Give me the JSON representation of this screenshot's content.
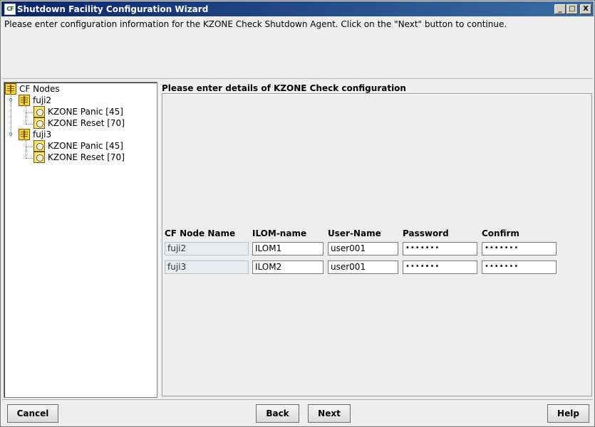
{
  "window": {
    "title": "Shutdown Facility Configuration Wizard",
    "icon_label": "CF",
    "minimize": "_",
    "maximize": "□",
    "close": "X"
  },
  "instructions": "Please enter configuration information for the KZONE Check Shutdown Agent. Click on the \"Next\" button to continue.",
  "tree": {
    "root": "CF Nodes",
    "nodes": [
      {
        "label": "fuji2",
        "children": [
          "KZONE Panic [45]",
          "KZONE Reset [70]"
        ]
      },
      {
        "label": "fuji3",
        "children": [
          "KZONE Panic [45]",
          "KZONE Reset [70]"
        ]
      }
    ]
  },
  "config": {
    "title": "Please enter details of KZONE Check configuration",
    "columns": [
      "CF Node Name",
      "ILOM-name",
      "User-Name",
      "Password",
      "Confirm"
    ],
    "rows": [
      {
        "node": "fuji2",
        "ilom": "ILOM1",
        "user": "user001",
        "password": "•••••••",
        "confirm": "•••••••"
      },
      {
        "node": "fuji3",
        "ilom": "ILOM2",
        "user": "user001",
        "password": "•••••••",
        "confirm": "•••••••"
      }
    ]
  },
  "buttons": {
    "cancel": "Cancel",
    "back": "Back",
    "next": "Next",
    "help": "Help"
  }
}
